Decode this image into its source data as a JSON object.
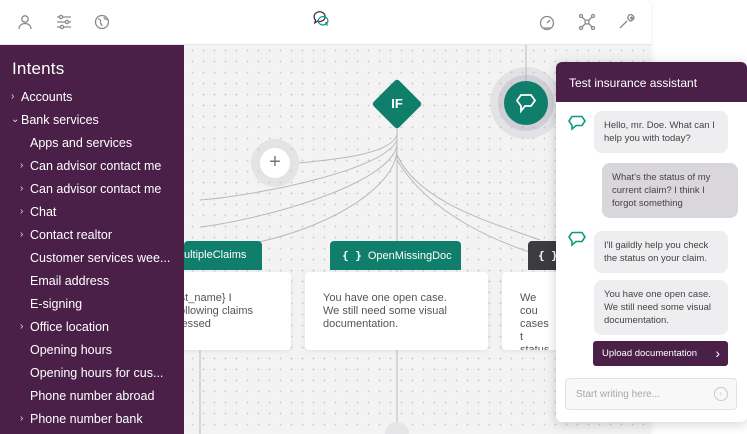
{
  "sidebar": {
    "title": "Intents",
    "items": [
      {
        "label": "Accounts",
        "chevron": "›",
        "child": false
      },
      {
        "label": "Bank services",
        "chevron": "⌄",
        "child": false
      },
      {
        "label": "Apps and services",
        "chevron": "",
        "child": true
      },
      {
        "label": "Can advisor contact me",
        "chevron": "›",
        "child": true
      },
      {
        "label": "Can advisor contact me",
        "chevron": "›",
        "child": true
      },
      {
        "label": "Chat",
        "chevron": "›",
        "child": true
      },
      {
        "label": "Contact realtor",
        "chevron": "›",
        "child": true
      },
      {
        "label": "Customer services wee...",
        "chevron": "",
        "child": true
      },
      {
        "label": "Email address",
        "chevron": "",
        "child": true
      },
      {
        "label": "E-signing",
        "chevron": "",
        "child": true
      },
      {
        "label": "Office location",
        "chevron": "›",
        "child": true
      },
      {
        "label": "Opening hours",
        "chevron": "",
        "child": true
      },
      {
        "label": "Opening hours for cus...",
        "chevron": "",
        "child": true
      },
      {
        "label": "Phone number abroad",
        "chevron": "",
        "child": true
      },
      {
        "label": "Phone number bank",
        "chevron": "›",
        "child": true
      }
    ]
  },
  "topbar": {
    "left_icons": [
      "user-icon",
      "sliders-icon",
      "globe-icon"
    ],
    "logo": "chat-logo-icon",
    "right_icons": [
      "speedometer-icon",
      "network-icon",
      "wrench-icon"
    ]
  },
  "flow": {
    "if_label": "IF",
    "blocks": [
      {
        "tag": "ultipleClaims",
        "brace": "",
        "tag_style": "green",
        "text": "rst_name} I\nfollowing claims\ncessed"
      },
      {
        "tag": "OpenMissingDoc",
        "brace": "{ }",
        "tag_style": "green",
        "text": "You have one open case.\nWe still need some visual\ndocumentation."
      },
      {
        "tag": "",
        "brace": "{ }",
        "tag_style": "dark",
        "text": "We cou\ncases t\nstatus"
      }
    ]
  },
  "chat": {
    "title": "Test insurance assistant",
    "messages": [
      {
        "from": "bot",
        "text": "Hello, mr. Doe. What can I help you with today?"
      },
      {
        "from": "user",
        "text": "What's the status of my current claim? I think I forgot something"
      },
      {
        "from": "bot",
        "text": "I'll gaildly help you check the status on your claim."
      },
      {
        "from": "bot",
        "text": "You have one open case. We still need some visual documentation."
      }
    ],
    "action_button": "Upload documentation",
    "input_placeholder": "Start writing here..."
  },
  "colors": {
    "brand_purple": "#4a2048",
    "brand_green": "#0f7e6b"
  }
}
